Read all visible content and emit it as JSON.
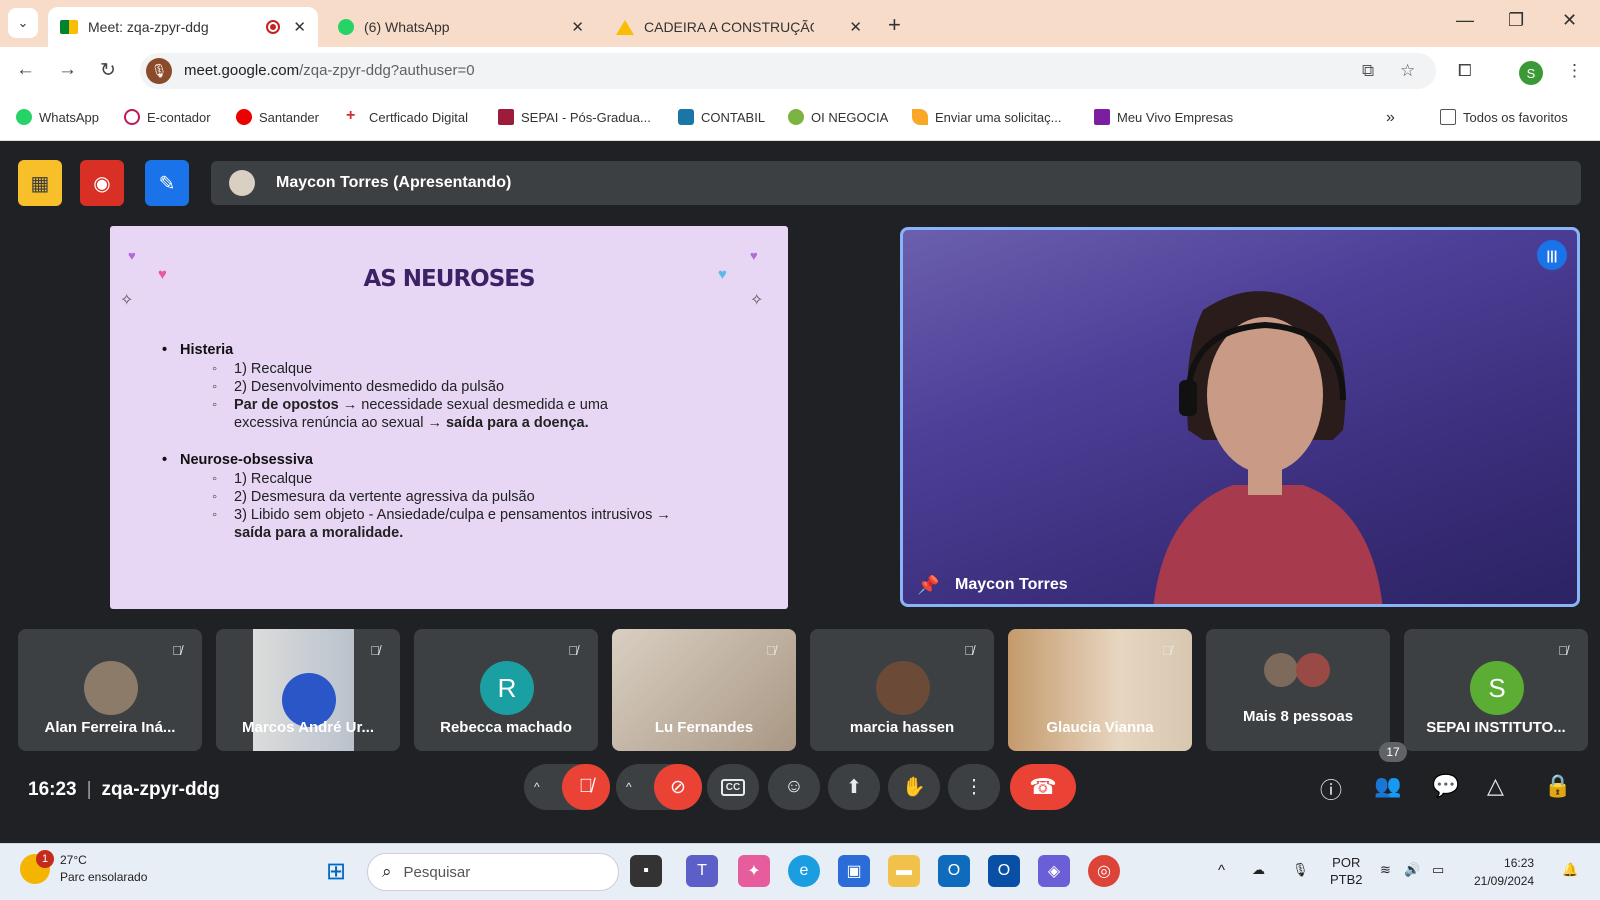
{
  "browser": {
    "tabs": [
      {
        "title": "Meet: zqa-zpyr-ddg",
        "active": true
      },
      {
        "title": "(6) WhatsApp",
        "active": false
      },
      {
        "title": "CADEIRA A CONSTRUÇÃO DA S",
        "active": false
      }
    ],
    "url_host": "meet.google.com",
    "url_path": "/zqa-zpyr-ddg?authuser=0",
    "profile_initial": "S",
    "bookmarks": [
      "WhatsApp",
      "E-contador",
      "Santander",
      "Certficado Digital",
      "SEPAI - Pós-Gradua...",
      "CONTABIL",
      "OI NEGOCIA",
      "Enviar uma solicitaç...",
      "Meu Vivo Empresas"
    ],
    "all_bookmarks": "Todos os favoritos"
  },
  "meet": {
    "presenting_banner": "Maycon Torres (Apresentando)",
    "slide": {
      "title": "AS NEUROSES",
      "sections": [
        {
          "heading": "Histeria",
          "items": [
            "1) Recalque",
            "2) Desenvolvimento desmedido da pulsão"
          ],
          "opposites_bold": "Par de opostos",
          "opposites_text": " → necessidade sexual desmedida e uma excessiva renúncia ao sexual → ",
          "opposites_end": "saída para a doença."
        },
        {
          "heading": "Neurose-obsessiva",
          "items": [
            "1) Recalque",
            "2) Desmesura da vertente agressiva da pulsão"
          ],
          "libido_text": "3) Libido sem objeto - Ansiedade/culpa e pensamentos intrusivos → ",
          "libido_end": "saída para a moralidade."
        }
      ]
    },
    "speaker_name": "Maycon Torres",
    "participants": [
      {
        "name": "Alan Ferreira Iná..."
      },
      {
        "name": "Marcos André Ur..."
      },
      {
        "name": "Rebecca machado",
        "initial": "R",
        "color": "#1a9fa3"
      },
      {
        "name": "Lu Fernandes"
      },
      {
        "name": "marcia hassen"
      },
      {
        "name": "Glaucia Vianna"
      },
      {
        "name": "Mais 8 pessoas"
      },
      {
        "name": "SEPAI INSTITUTO...",
        "initial": "S",
        "color": "#5cad34"
      }
    ],
    "time": "16:23",
    "meeting_code": "zqa-zpyr-ddg",
    "people_count": "17"
  },
  "taskbar": {
    "temperature": "27°C",
    "weather": "Parc ensolarado",
    "notification_count": "1",
    "search_placeholder": "Pesquisar",
    "lang1": "POR",
    "lang2": "PTB2",
    "clock_time": "16:23",
    "clock_date": "21/09/2024"
  }
}
